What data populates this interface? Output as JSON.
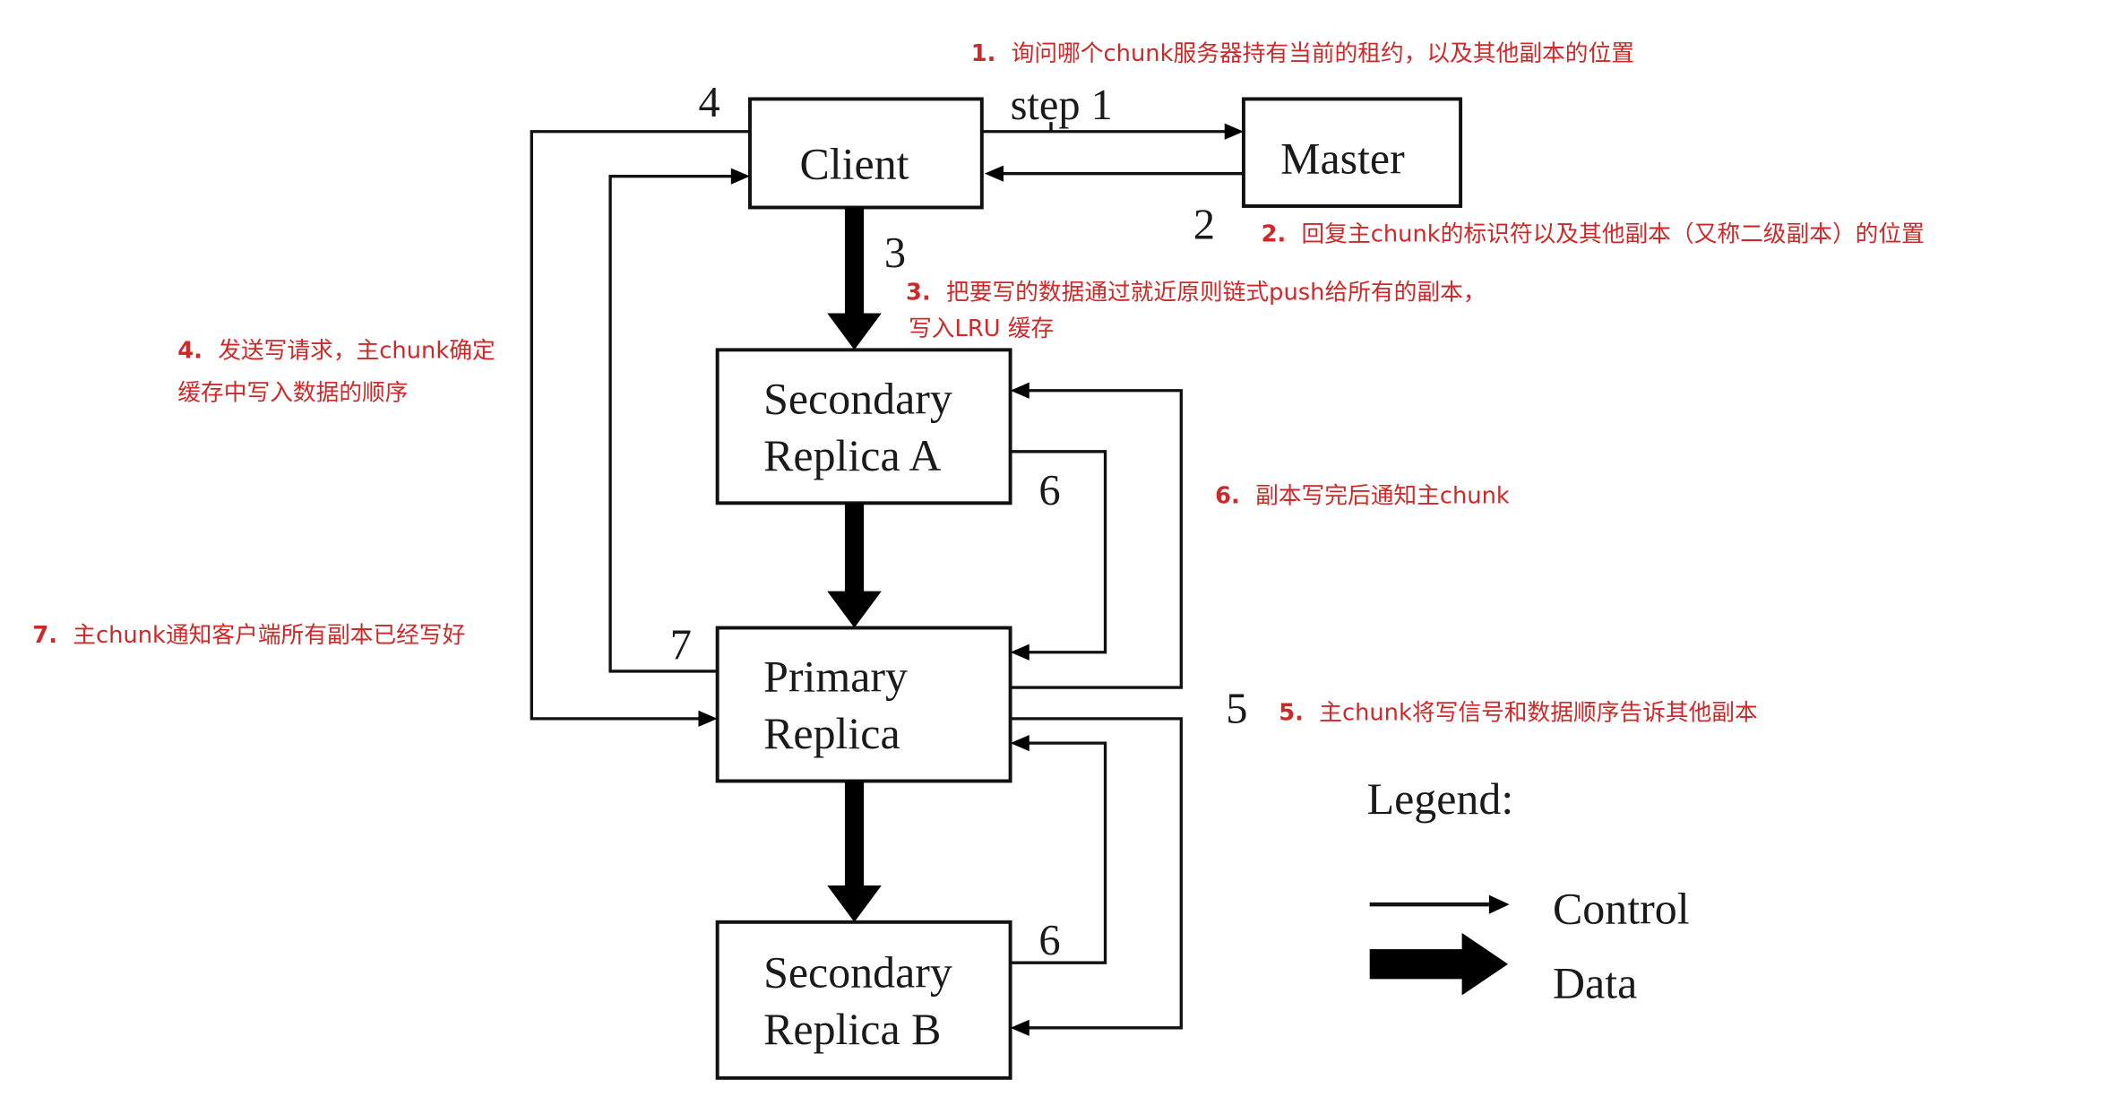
{
  "diagram": {
    "type": "GFS write control and data flow",
    "nodes": {
      "client": {
        "lines": [
          "Client"
        ]
      },
      "master": {
        "lines": [
          "Master"
        ]
      },
      "secondary_a": {
        "lines": [
          "Secondary",
          "Replica A"
        ]
      },
      "primary": {
        "lines": [
          "Primary",
          "Replica"
        ]
      },
      "secondary_b": {
        "lines": [
          "Secondary",
          "Replica B"
        ]
      }
    },
    "step_labels": {
      "step1": "step 1",
      "step2": "2",
      "step3": "3",
      "step4": "4",
      "step5": "5",
      "step6_a": "6",
      "step6_b": "6",
      "step7": "7"
    },
    "edges": [
      {
        "from": "client",
        "to": "master",
        "kind": "control",
        "step": "1"
      },
      {
        "from": "master",
        "to": "client",
        "kind": "control",
        "step": "2"
      },
      {
        "from": "client",
        "to": "secondary_a",
        "kind": "data",
        "step": "3"
      },
      {
        "from": "secondary_a",
        "to": "primary",
        "kind": "data",
        "step": "3"
      },
      {
        "from": "primary",
        "to": "secondary_b",
        "kind": "data",
        "step": "3"
      },
      {
        "from": "client",
        "to": "primary",
        "kind": "control",
        "step": "4"
      },
      {
        "from": "primary",
        "to": "secondary_a",
        "kind": "control",
        "step": "5"
      },
      {
        "from": "primary",
        "to": "secondary_b",
        "kind": "control",
        "step": "5"
      },
      {
        "from": "secondary_a",
        "to": "primary",
        "kind": "control",
        "step": "6"
      },
      {
        "from": "secondary_b",
        "to": "primary",
        "kind": "control",
        "step": "6"
      },
      {
        "from": "primary",
        "to": "client",
        "kind": "control",
        "step": "7"
      }
    ],
    "legend": {
      "title": "Legend:",
      "control": "Control",
      "data": "Data"
    }
  },
  "annotations": {
    "a1": {
      "num": "1.",
      "lines": [
        "询问哪个chunk服务器持有当前的租约，以及其他副本的位置"
      ]
    },
    "a2": {
      "num": "2.",
      "lines": [
        "回复主chunk的标识符以及其他副本（又称二级副本）的位置"
      ]
    },
    "a3": {
      "num": "3.",
      "lines": [
        "把要写的数据通过就近原则链式push给所有的副本，",
        "写入LRU 缓存"
      ]
    },
    "a4": {
      "num": "4.",
      "lines": [
        "发送写请求，主chunk确定",
        "缓存中写入数据的顺序"
      ]
    },
    "a5": {
      "num": "5.",
      "lines": [
        "主chunk将写信号和数据顺序告诉其他副本"
      ]
    },
    "a6": {
      "num": "6.",
      "lines": [
        "副本写完后通知主chunk"
      ]
    },
    "a7": {
      "num": "7.",
      "lines": [
        "主chunk通知客户端所有副本已经写好"
      ]
    }
  },
  "colors": {
    "annotation": "#cc2a2a",
    "ink": "#111111"
  }
}
